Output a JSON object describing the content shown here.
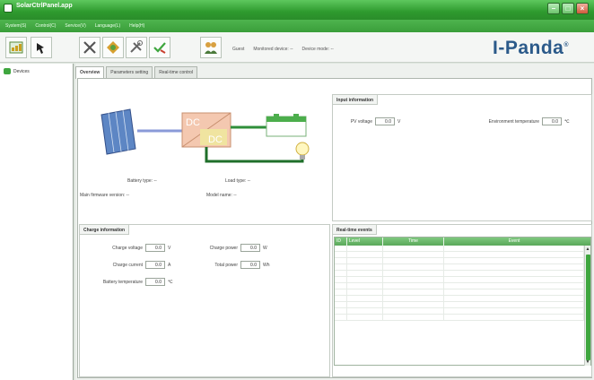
{
  "window": {
    "title": "SolarCtrlPanel.app"
  },
  "menu": [
    "System(S)",
    "Control(C)",
    "Service(V)",
    "Language(L)",
    "Help(H)"
  ],
  "toolbar": {
    "buttons": [
      {
        "name": "connect-icon"
      },
      {
        "name": "device-icon"
      },
      {
        "name": "tools-icon"
      },
      {
        "name": "settings-icon"
      },
      {
        "name": "tools2-icon"
      },
      {
        "name": "check-icon"
      },
      {
        "name": "users-icon"
      }
    ],
    "guest": "Guest",
    "monitored_device": "Monitored device: --",
    "device_mode": "Device mode: --"
  },
  "brand": {
    "name": "I-Panda",
    "mark": "®"
  },
  "sidebar": {
    "root": "Devices"
  },
  "tabs": [
    "Overview",
    "Parameters setting",
    "Real-time control"
  ],
  "diagram": {
    "dc1": "DC",
    "dc2": "DC"
  },
  "overview_info": {
    "battery_type": "Battery type: --",
    "load_type": "Load type: --",
    "firmware": "Main firmware version: --",
    "model": "Model name: --"
  },
  "input_information": {
    "title": "Input information",
    "pv_voltage": {
      "label": "PV voltage",
      "value": "0.0",
      "unit": "V"
    },
    "env_temp": {
      "label": "Environment temperature",
      "value": "0.0",
      "unit": "℃"
    }
  },
  "charge_information": {
    "title": "Charge information",
    "charge_voltage": {
      "label": "Charge voltage",
      "value": "0.0",
      "unit": "V"
    },
    "charge_current": {
      "label": "Charge current",
      "value": "0.0",
      "unit": "A"
    },
    "battery_temp": {
      "label": "Battery temperature",
      "value": "0.0",
      "unit": "℃"
    },
    "charge_power": {
      "label": "Charge power",
      "value": "0.0",
      "unit": "W"
    },
    "total_power": {
      "label": "Total power",
      "value": "0.0",
      "unit": "Wh"
    }
  },
  "events": {
    "title": "Real-time events",
    "columns": [
      "ID",
      "Level",
      "Time",
      "Event"
    ]
  },
  "colors": {
    "titlebar": "#2e9a2e",
    "accent": "#3ea63e",
    "brand": "#2b5a8a"
  }
}
